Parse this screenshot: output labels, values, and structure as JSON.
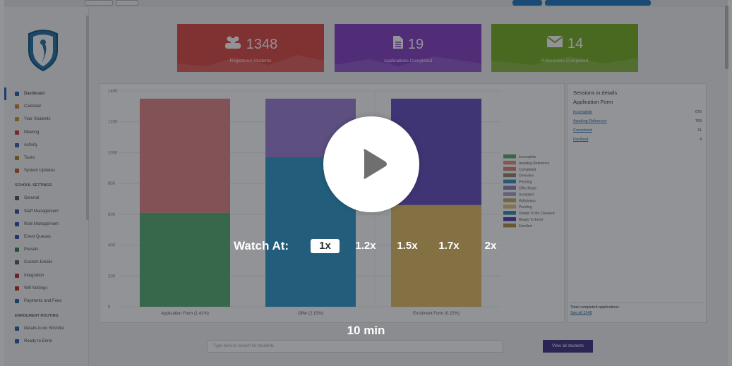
{
  "colors": {
    "card1": "#e0514d",
    "card2": "#8e49c9",
    "card3": "#7fb52f",
    "overlay": "rgba(5,10,15,0.44)"
  },
  "stats": [
    {
      "value": "1348",
      "caption": "Registered Students",
      "icon": "users-icon"
    },
    {
      "value": "19",
      "caption": "Applications Completed",
      "icon": "document-icon"
    },
    {
      "value": "14",
      "caption": "References Completed",
      "icon": "envelope-icon"
    }
  ],
  "sidebar": {
    "items": [
      {
        "label": "Dashboard",
        "icon": "dashboard-icon",
        "color": "#2b6cb0"
      },
      {
        "label": "Calendar",
        "icon": "calendar-icon",
        "color": "#d58a3b"
      },
      {
        "label": "Your Students",
        "icon": "students-icon",
        "color": "#c9a227"
      },
      {
        "label": "Meeting",
        "icon": "meeting-icon",
        "color": "#d0413d"
      },
      {
        "label": "Activity",
        "icon": "activity-icon",
        "color": "#3f6db5"
      },
      {
        "label": "Tasks",
        "icon": "tasks-icon",
        "color": "#b38a2d"
      },
      {
        "label": "System Updates",
        "icon": "updates-icon",
        "color": "#c8642f"
      }
    ],
    "section1": "SCHOOL SETTINGS",
    "settings": [
      {
        "label": "General",
        "icon": "general-icon",
        "color": "#555f6e"
      },
      {
        "label": "Staff Management",
        "icon": "staff-icon",
        "color": "#3b5ea8"
      },
      {
        "label": "Role Management",
        "icon": "role-icon",
        "color": "#3b5ea8"
      },
      {
        "label": "Event Queues",
        "icon": "queue-icon",
        "color": "#3b5ea8"
      },
      {
        "label": "Presets",
        "icon": "presets-icon",
        "color": "#3a8b4c"
      },
      {
        "label": "Custom Emails",
        "icon": "emails-icon",
        "color": "#666666"
      },
      {
        "label": "Integration",
        "icon": "integration-icon",
        "color": "#c0392b"
      },
      {
        "label": "Wifi Settings",
        "icon": "wifi-icon",
        "color": "#c0392b"
      },
      {
        "label": "Payments and Fees",
        "icon": "payments-icon",
        "color": "#2b6cb0"
      }
    ],
    "section2": "ENROLMENT ROUTING",
    "routing": [
      {
        "label": "Details to do Shortlist",
        "icon": "shortlist-icon",
        "color": "#2b6cb0"
      },
      {
        "label": "Ready to Enrol",
        "icon": "enrol-icon",
        "color": "#2b6cb0"
      }
    ]
  },
  "chart_data": {
    "type": "bar",
    "stacked": true,
    "categories": [
      "Application Form (1.41%)",
      "Offer (2.15%)",
      "Enrolment Form (0.22%)"
    ],
    "ylim": [
      0,
      1400
    ],
    "yticks": [
      0,
      200,
      400,
      600,
      800,
      1000,
      1200,
      1400
    ],
    "grid": true,
    "legend_position": "right",
    "series": [
      {
        "name": "Incomplete",
        "color": "#63b07a",
        "values": [
          0,
          0,
          0
        ]
      },
      {
        "name": "Awaiting Reference",
        "color": "#e69a86",
        "values": [
          0,
          0,
          0
        ]
      },
      {
        "name": "Completed",
        "color": "#d98b79",
        "values": [
          0,
          0,
          0
        ]
      },
      {
        "name": "Overview",
        "color": "#9c8a7b",
        "values": [
          0,
          0,
          0
        ]
      },
      {
        "name": "Pending",
        "color": "#3e9ac4",
        "values": [
          0,
          0,
          0
        ]
      },
      {
        "name": "Offer Made",
        "color": "#9a89c4",
        "values": [
          0,
          0,
          0
        ]
      },
      {
        "name": "Accepted",
        "color": "#b7a4d6",
        "values": [
          0,
          0,
          0
        ]
      },
      {
        "name": "Withdrawn",
        "color": "#c9ad71",
        "values": [
          0,
          0,
          0
        ]
      },
      {
        "name": "Pending",
        "color": "#e8c67a",
        "values": [
          0,
          0,
          0
        ]
      },
      {
        "name": "Details To Be Checked",
        "color": "#3f8fbf",
        "values": [
          0,
          0,
          0
        ]
      },
      {
        "name": "Ready To Enrol",
        "color": "#5a49b5",
        "values": [
          0,
          0,
          0
        ]
      },
      {
        "name": "Enrolled",
        "color": "#b5964e",
        "values": [
          0,
          0,
          0
        ]
      }
    ],
    "stacks": [
      [
        {
          "color": "#5fb27a",
          "value": 610
        },
        {
          "color": "#e58c8f",
          "value": 740
        }
      ],
      [
        {
          "color": "#3aa1d1",
          "value": 970
        },
        {
          "color": "#a287d6",
          "value": 380
        }
      ],
      [
        {
          "color": "#e6c16c",
          "value": 660
        },
        {
          "color": "#6e58c4",
          "value": 690
        }
      ]
    ]
  },
  "panel": {
    "title1": "Sessions in details",
    "title2": "Application Form",
    "rows": [
      {
        "label": "Incomplete",
        "value": "679"
      },
      {
        "label": "Awaiting Reference",
        "value": "759"
      },
      {
        "label": "Completed",
        "value": "11"
      },
      {
        "label": "Declined",
        "value": "4"
      }
    ],
    "footer_title": "Total completed applications",
    "footer_link": "See all 1348"
  },
  "search": {
    "placeholder": "Type here to search for students"
  },
  "view_all": "View all students",
  "overlay": {
    "watch_label": "Watch At:",
    "speeds": [
      "1x",
      "1.2x",
      "1.5x",
      "1.7x",
      "2x"
    ],
    "selected_speed": "1x",
    "duration": "10 min"
  }
}
